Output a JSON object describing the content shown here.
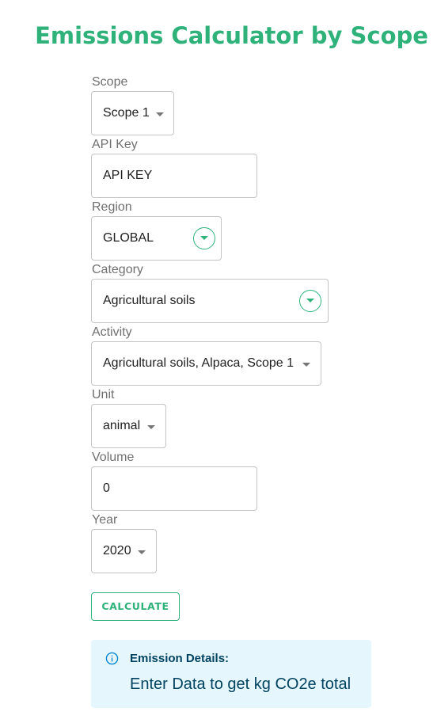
{
  "header": {
    "title": "Emissions Calculator by Scope"
  },
  "form": {
    "scope": {
      "label": "Scope",
      "value": "Scope 1"
    },
    "api_key": {
      "label": "API Key",
      "value": "API KEY"
    },
    "region": {
      "label": "Region",
      "value": "GLOBAL"
    },
    "category": {
      "label": "Category",
      "value": "Agricultural soils"
    },
    "activity": {
      "label": "Activity",
      "value": "Agricultural soils, Alpaca, Scope 1"
    },
    "unit": {
      "label": "Unit",
      "value": "animal"
    },
    "volume": {
      "label": "Volume",
      "value": "0"
    },
    "year": {
      "label": "Year",
      "value": "2020"
    },
    "calculate_label": "CALCULATE"
  },
  "alert": {
    "icon": "info-icon",
    "title": "Emission Details:",
    "body": "Enter Data to get kg CO2e total"
  },
  "colors": {
    "accent": "#2fb27a",
    "info_bg": "#e5f6fd",
    "info_text": "#014361"
  }
}
